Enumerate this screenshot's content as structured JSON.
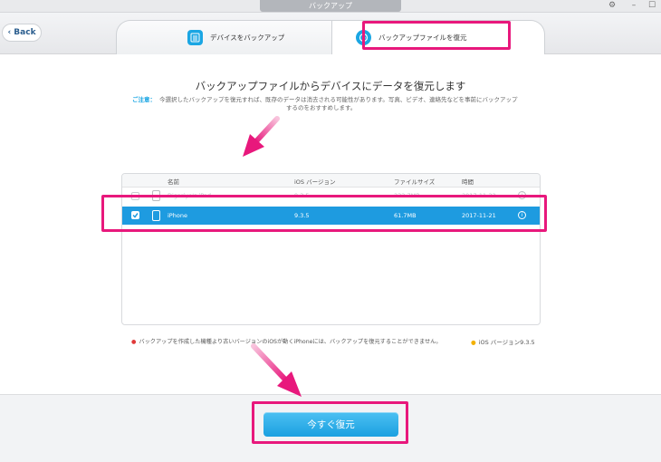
{
  "window": {
    "title": "バックアップ",
    "gear_icon": "⚙",
    "minimize": "–",
    "maximize": "☐"
  },
  "header": {
    "back_label": "Back",
    "tabs": [
      {
        "label": "デバイスをバックアップ",
        "icon": "list-icon"
      },
      {
        "label": "バックアップファイルを復元",
        "icon": "restore-clock-icon"
      }
    ]
  },
  "main": {
    "heading": "バックアップファイルからデバイスにデータを復元します",
    "notice_label": "ご注意：",
    "notice_line1": "今選択したバックアップを復元すれば、既存のデータは消去される可能性があります。写真、ビデオ、連絡先などを事前にバックアップ",
    "notice_line2": "するのをおすすめします。"
  },
  "table": {
    "columns": [
      "名前",
      "iOS バージョン",
      "ファイルサイズ",
      "時間"
    ],
    "rows": [
      {
        "name": "Digariyo's iPad",
        "ios": "9.3.5",
        "size": "232.7MB",
        "time": "2017-11-22",
        "selected": false
      },
      {
        "name": "iPhone",
        "ios": "9.3.5",
        "size": "61.7MB",
        "time": "2017-11-21",
        "selected": true
      }
    ]
  },
  "footnotes": {
    "left": "バックアップを作成した機種より古いバージョンのiOSが動くiPhoneには、バックアップを復元することができません。",
    "right": "iOS  バージョン9.3.5"
  },
  "actions": {
    "restore_label": "今すぐ復元"
  },
  "colors": {
    "accent": "#1ba6e3",
    "highlight": "#e8187c",
    "selected_row": "#1e9be0"
  }
}
